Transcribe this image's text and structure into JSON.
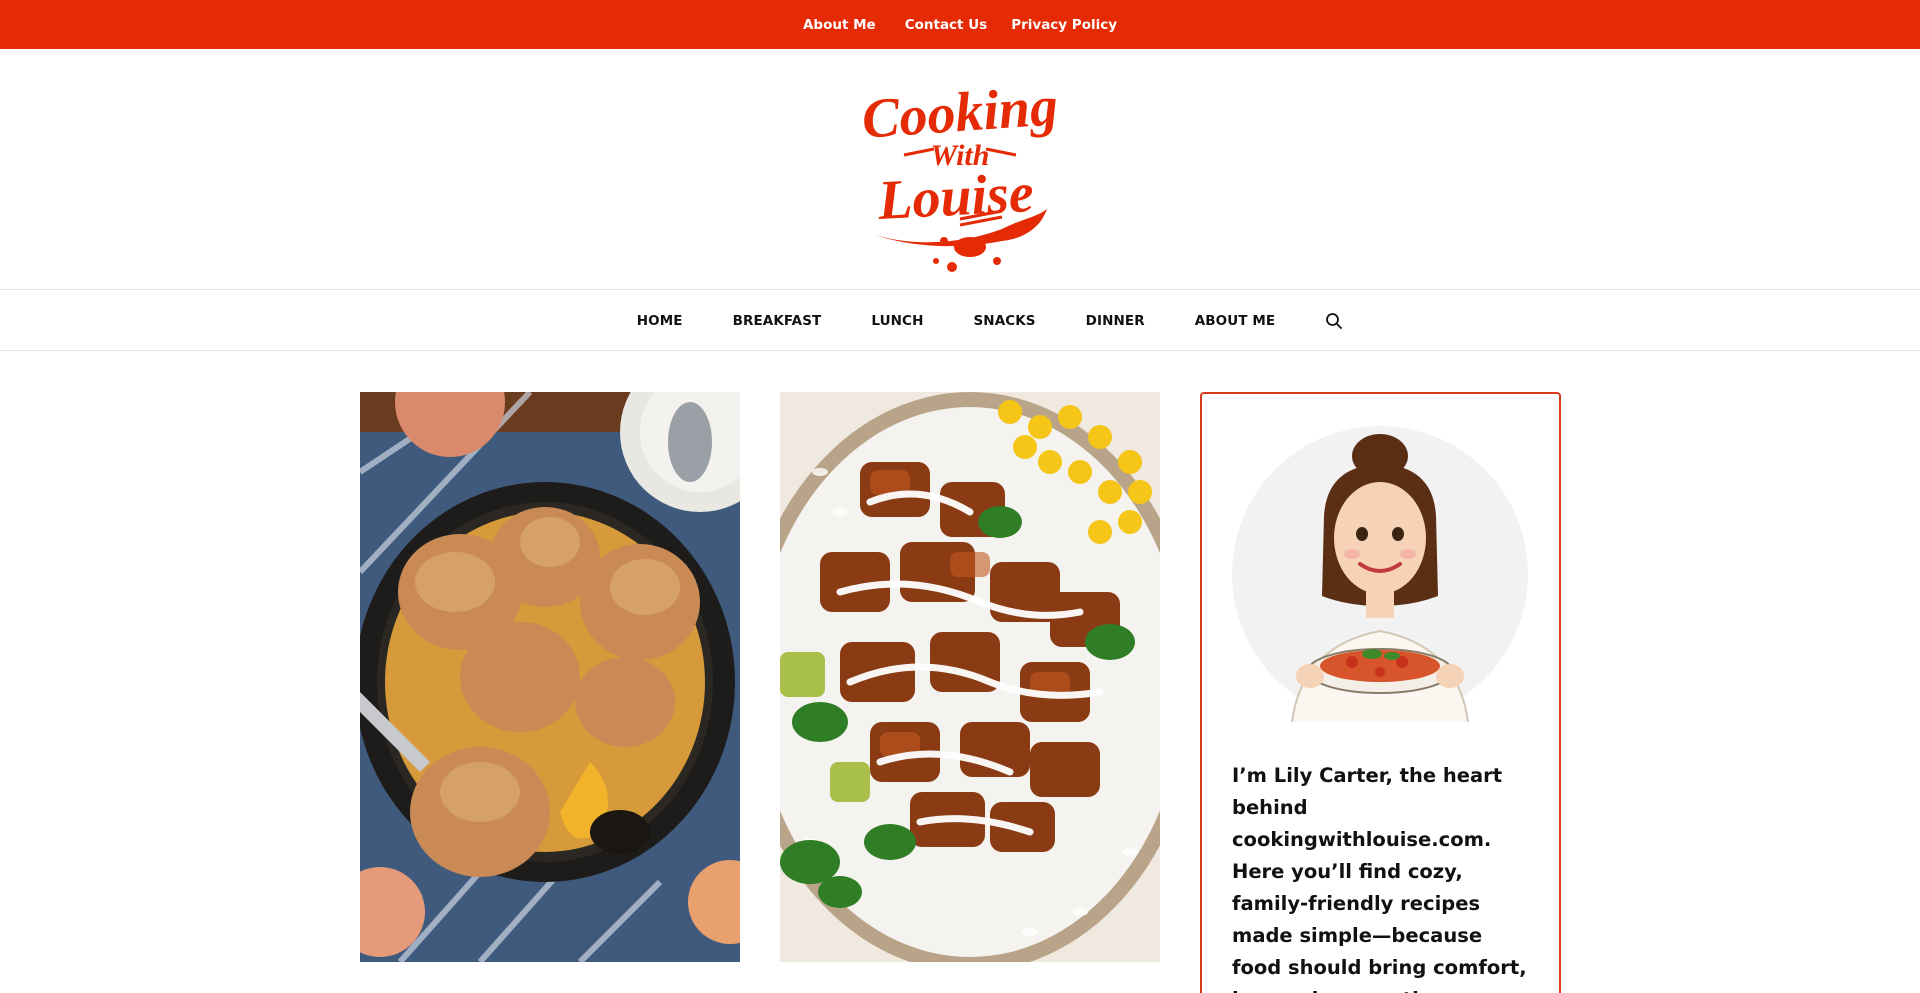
{
  "topbar": {
    "links": [
      "About Me",
      "Contact Us",
      "Privacy Policy"
    ],
    "background": "#e42b05"
  },
  "logo": {
    "line1": "Cooking",
    "line2": "With",
    "line3": "Louise",
    "color": "#e42b05"
  },
  "nav": {
    "items": [
      "HOME",
      "BREAKFAST",
      "LUNCH",
      "SNACKS",
      "DINNER",
      "ABOUT ME"
    ],
    "search_icon": "search-icon"
  },
  "posts": [
    {
      "image": "peach cobbler in cast iron skillet"
    },
    {
      "image": "chicken rice bowl with corn and avocado"
    }
  ],
  "about": {
    "avatar": "chef illustration holding pasta bowl",
    "text": "I’m Lily Carter, the heart behind cookingwithlouise.com. Here you’ll find cozy, family-friendly recipes made simple—because food should bring comfort, joy, and connection",
    "border_color": "#d63b1f"
  }
}
